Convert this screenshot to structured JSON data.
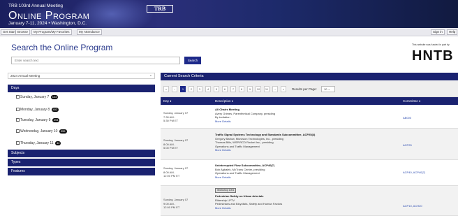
{
  "banner": {
    "line1": "TRB 103rd Annual Meeting",
    "title": "Online Program",
    "dates": "January 7-11, 2024  •  Washington, D.C.",
    "logo": "TRB"
  },
  "subnav": {
    "buttons": [
      "Get Started",
      "Browse",
      "My Program/My Favorites",
      "My Attendance"
    ],
    "right_buttons": [
      "Sign in",
      "Help"
    ]
  },
  "page_title": "Search the Online Program",
  "search": {
    "placeholder": "Enter search text",
    "button": "Search"
  },
  "sponsor": {
    "note": "This website was funded in part by",
    "logo": "HNTB"
  },
  "meeting_select": "2024 Annual Meeting",
  "facets": {
    "days_label": "Days",
    "days": [
      {
        "label": "Sunday, January 7",
        "count": "123"
      },
      {
        "label": "Monday, January 8",
        "count": "402"
      },
      {
        "label": "Tuesday, January 9",
        "count": "394"
      },
      {
        "label": "Wednesday, January 10",
        "count": "355"
      },
      {
        "label": "Thursday, January 11",
        "count": "42"
      }
    ],
    "subjects": "Subjects",
    "types": "Types",
    "features": "Features"
  },
  "results": {
    "header": "Current Search Criteria",
    "pages": [
      "«",
      "‹",
      "1",
      "2",
      "3",
      "4",
      "5",
      "6",
      "7",
      "8",
      "9",
      "10",
      "11",
      "›",
      "»"
    ],
    "active_page": "1",
    "rpp_label": "Results per Page:",
    "rpp_value": "10",
    "columns": {
      "day": "Day ♦",
      "description": "Description ♦",
      "committee": "Committee ♦"
    },
    "rows": [
      {
        "day": [
          "Sunday, January 07",
          "7:30 AM -",
          "5:30 PM ET"
        ],
        "title": "All Chairs Meeting",
        "lines": [
          "Avery Grimes, Parenthetical Company, presiding",
          "By invitation"
        ],
        "more": "More Details",
        "committee": "AB000"
      },
      {
        "day": [
          "Sunday, January 07",
          "8:00 AM -",
          "5:00 PM ET"
        ],
        "title": "Traffic Signal Systems Technology and Standards Subcommittee, ACP25(4)",
        "lines": [
          "Gregory Barlow, Miovision Technologies, Inc., presiding",
          "Thomas Bills, WSP/RCD Rocket Inc., presiding",
          "Operations and Traffic Management"
        ],
        "more": "More Details",
        "committee": "ACP25"
      },
      {
        "day": [
          "Sunday, January 07",
          "8:00 AM -",
          "12:00 PM ET"
        ],
        "title": "Uninterrupted Flow Subcommittee, ACP40(7)",
        "lines": [
          "Bob Agbalek, McTrans Center, presiding",
          "Operations and Traffic Management"
        ],
        "more": "More Details",
        "committee": "ACP40, ACP40(7)"
      },
      {
        "tag": "Workshop 1001",
        "day": [
          "Sunday, January 07",
          "9:00 AM -",
          "12:00 PM ET"
        ],
        "title": "Pedestrian Safety on Urban Arterials",
        "lines": [
          "Ridership LPTV",
          "Pedestrians and Bicyclists, Safety and Human Factors"
        ],
        "more": "More Details",
        "committee": "ACP10, ACH20"
      }
    ]
  }
}
